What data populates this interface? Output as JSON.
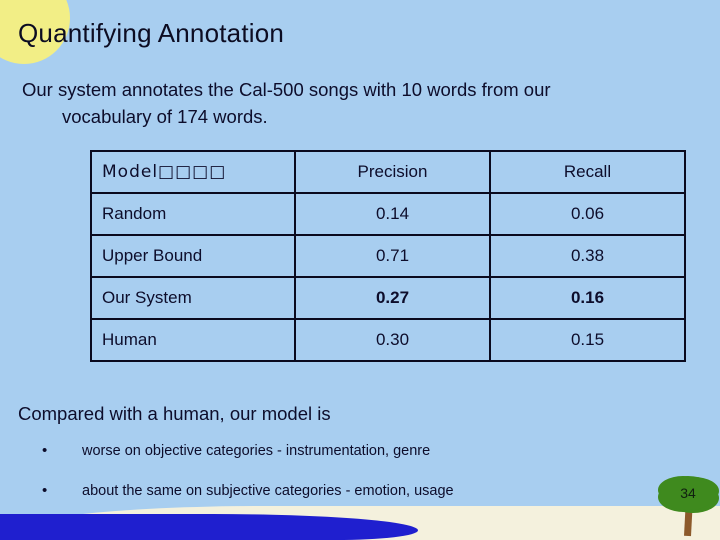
{
  "slide": {
    "title": "Quantifying Annotation",
    "lead_line1": "Our system annotates the Cal-500 songs with 10 words from our",
    "lead_line2": "vocabulary of 174 words.",
    "compare_line": "Compared with a human, our model is",
    "number": "34"
  },
  "table": {
    "headers": [
      "Model□□□□",
      "Precision",
      "Recall"
    ],
    "rows": [
      {
        "model": "Random",
        "precision": "0.14",
        "recall": "0.06",
        "style": "plain"
      },
      {
        "model": "Upper Bound",
        "precision": "0.71",
        "recall": "0.38",
        "style": "plain"
      },
      {
        "model": "Our System",
        "precision": "0.27",
        "recall": "0.16",
        "style": "blue"
      },
      {
        "model": "Human",
        "precision": "0.30",
        "recall": "0.15",
        "style": "green"
      }
    ]
  },
  "bullets": [
    {
      "marker": "•",
      "text": "worse on objective categories - instrumentation, genre"
    },
    {
      "marker": "•",
      "text": "about the same on subjective categories - emotion, usage"
    }
  ],
  "colors": {
    "background": "#a8cef0",
    "text": "#0d0d2b",
    "highlight_blue": "#2020c8",
    "highlight_green": "#4a8a3a",
    "sun": "#f2ee86",
    "water": "#1f1fcf",
    "sand": "#f4f1dd",
    "tree_canopy": "#3f8a1e",
    "tree_trunk": "#8c5a2b"
  }
}
